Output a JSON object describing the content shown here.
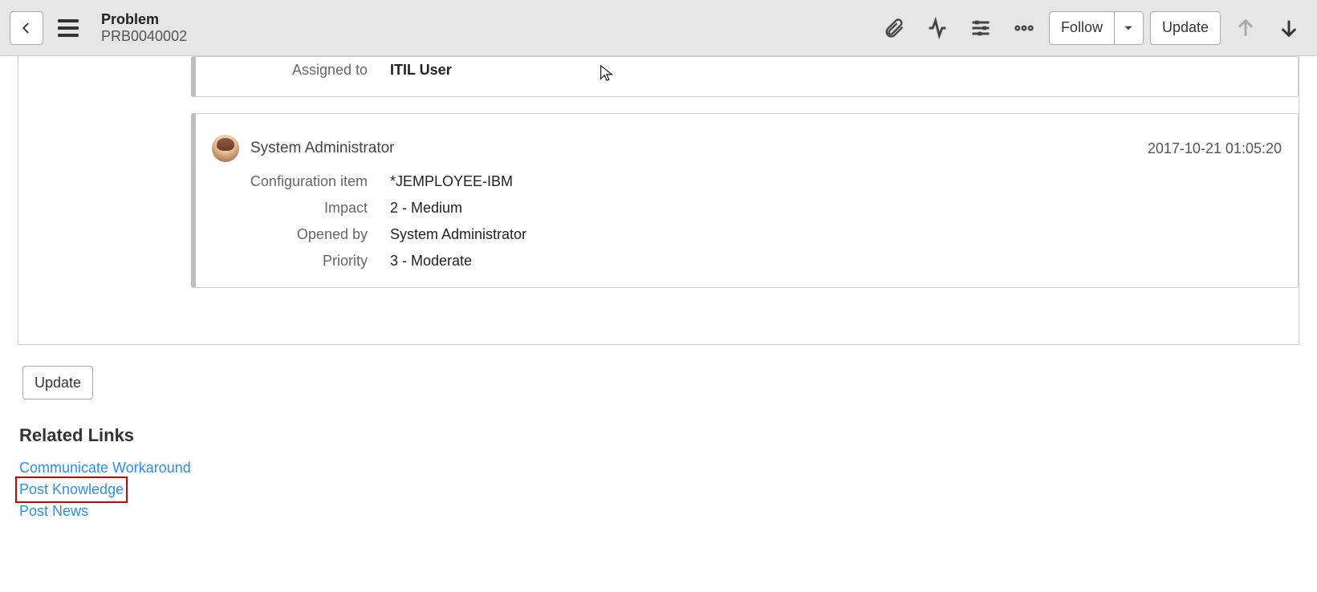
{
  "header": {
    "title": "Problem",
    "record_number": "PRB0040002",
    "follow_label": "Follow",
    "update_label": "Update"
  },
  "activity_top": {
    "fields": {
      "assigned_to_label": "Assigned to",
      "assigned_to_value": "ITIL User"
    }
  },
  "activity_main": {
    "user": "System Administrator",
    "timestamp": "2017-10-21 01:05:20",
    "fields": {
      "config_item_label": "Configuration item",
      "config_item_value": "*JEMPLOYEE-IBM",
      "impact_label": "Impact",
      "impact_value": "2 - Medium",
      "opened_by_label": "Opened by",
      "opened_by_value": "System Administrator",
      "priority_label": "Priority",
      "priority_value": "3 - Moderate"
    }
  },
  "bottom": {
    "update_label": "Update",
    "related_links_heading": "Related Links",
    "links": {
      "communicate": "Communicate Workaround",
      "post_knowledge": "Post Knowledge",
      "post_news": "Post News"
    }
  }
}
